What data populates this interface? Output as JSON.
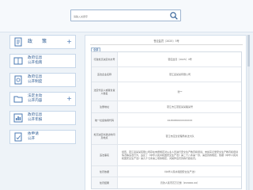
{
  "search": {
    "placeholder": "请输入关键字",
    "button_icon": "search-icon"
  },
  "sidebar": {
    "items": [
      {
        "label": "政　策",
        "icon": "doc-icon",
        "expandable": true
      },
      {
        "label": "政府信息\n公开指南",
        "icon": "guide-icon",
        "expandable": false
      },
      {
        "label": "政府信息\n公开制度",
        "icon": "rules-icon",
        "expandable": false
      },
      {
        "label": "法定主动\n公开内容",
        "icon": "folder-icon",
        "expandable": true
      },
      {
        "label": "政府信息\n公开年报",
        "icon": "report-icon",
        "expandable": false
      },
      {
        "label": "依申请\n公开",
        "icon": "apply-icon",
        "expandable": false
      }
    ],
    "plus_glyph": "+"
  },
  "document": {
    "title": "苍应监罚〔2025〕3号",
    "tag": "全部",
    "rows": [
      {
        "label": "行政处罚决定书文号",
        "value": "苍应监罚〔2025〕3号"
      },
      {
        "label": "违法企业名称",
        "value": "苍江县某某有限公司"
      },
      {
        "label": "法定代表人或者负责人姓名",
        "value": "张**"
      },
      {
        "label": "注册地址",
        "value": "苍江市江苍区某某路某号"
      },
      {
        "label": "统一社会信用代码",
        "value": "91450800XXXXXXXX"
      },
      {
        "label": "处罚决定书送达时间及地点",
        "value": "苍江市应急管理局执法大队"
      },
      {
        "label": "违法事实",
        "value": "经查，苍江县某某有限公司存在未按规定对从业人员进行安全生产教育和培训，未如实记录安全生产教育和培训情况等违法行为，违反了《中华人民共和国安全生产法》第二十八条第一款、第四款的规定，依据《中华人民共和国安全生产法》第九十七条第三项的规定，对其作出罚款的行政处罚。"
      },
      {
        "label": "处罚依据",
        "value": "《中华人民共和国安全生产法》"
      },
      {
        "label": "处罚结果",
        "value": "罚款人民币贰万元整（¥20000.00）"
      }
    ]
  },
  "colors": {
    "accent": "#2b5a93",
    "border": "#c7d7e9",
    "page_bg": "#eef3f8"
  }
}
